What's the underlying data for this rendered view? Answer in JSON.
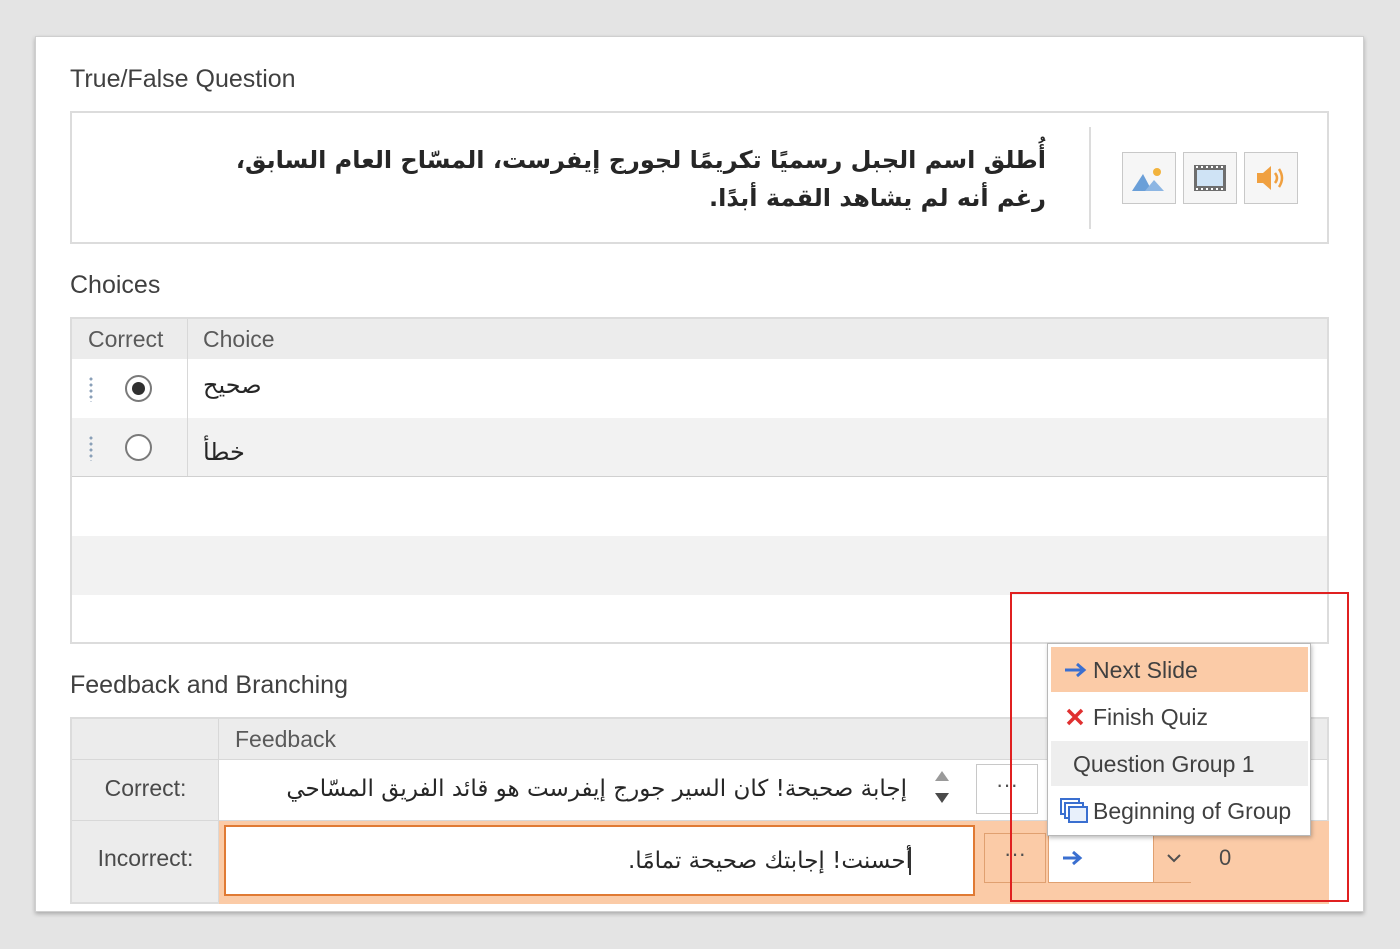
{
  "question": {
    "title": "True/False Question",
    "text_line1": "أُطلق اسم الجبل رسميًا تكريمًا لجورج إيفرست، المسّاح العام السابق،",
    "text_line2": "رغم أنه لم يشاهد القمة أبدًا.",
    "media_buttons": [
      "image-icon",
      "video-icon",
      "audio-icon"
    ]
  },
  "choices": {
    "title": "Choices",
    "columns": [
      "Correct",
      "Choice"
    ],
    "rows": [
      {
        "correct": true,
        "text": "صحيح"
      },
      {
        "correct": false,
        "text": "خطأ"
      }
    ]
  },
  "feedback": {
    "title": "Feedback and Branching",
    "column": "Feedback",
    "correct_label": "Correct:",
    "correct_text": "إجابة صحيحة! كان السير جورج إيفرست هو قائد الفريق المسّاحي",
    "incorrect_label": "Incorrect:",
    "incorrect_text": "أحسنت! إجابتك صحيحة تمامًا.",
    "ellipsis": "···",
    "points": "0"
  },
  "branch_dropdown": {
    "options": [
      {
        "label": "Next Slide",
        "icon": "arrow-right-icon",
        "state": "selected"
      },
      {
        "label": "Finish Quiz",
        "icon": "red-x-icon",
        "state": "normal"
      },
      {
        "label": "Question Group 1",
        "icon": "",
        "state": "hover"
      },
      {
        "label": "Beginning of Group",
        "icon": "group-icon",
        "state": "normal"
      }
    ],
    "highlight_color": "#fbcba7",
    "hover_color": "#eeeeee",
    "annotation_color": "#e02020"
  }
}
